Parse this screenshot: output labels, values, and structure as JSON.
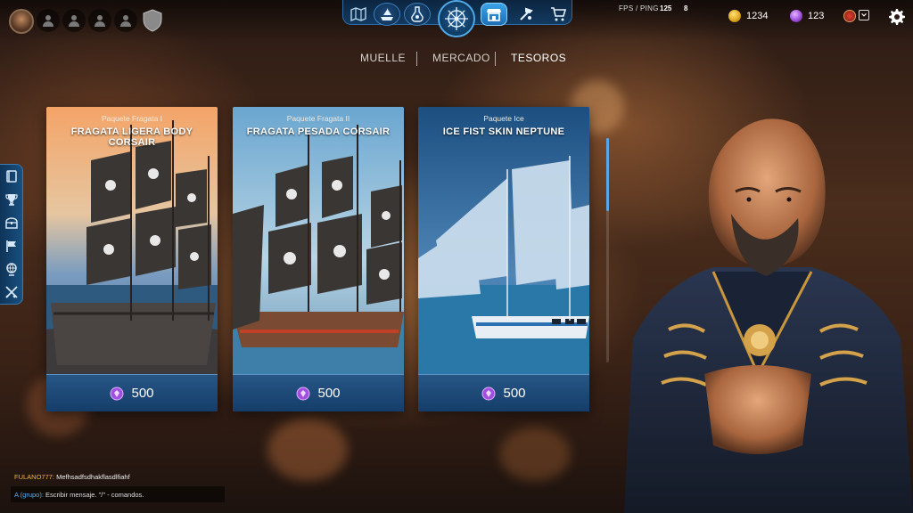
{
  "top_bar": {
    "avatar_icon": "pirate-portrait-avatar",
    "party_slots": [
      "person-icon",
      "person-icon",
      "person-icon",
      "person-icon"
    ],
    "guild_icon": "shield-icon",
    "fps_label": "FPS / PING",
    "fps_value": "125",
    "ping_value": "8",
    "gold_amount": "1234",
    "gems_amount": "123",
    "gold_color": "#e0a820",
    "gem_color": "#a050e0"
  },
  "nav": {
    "buttons": [
      "map-icon",
      "ship-icon",
      "potion-icon",
      "helm-icon",
      "shop-icon",
      "craft-icon",
      "cart-icon"
    ],
    "active": "shop-icon"
  },
  "tabs": {
    "items": [
      "MUELLE",
      "MERCADO",
      "TESOROS"
    ],
    "active": "TESOROS"
  },
  "side_rail": [
    "book-icon",
    "trophy-icon",
    "chest-icon",
    "flag-icon",
    "globe-icon",
    "crossed-swords-icon"
  ],
  "cards": [
    {
      "subtitle": "Paquete Fragata I",
      "title": "FRAGATA LIGERA BODY CORSAIR",
      "price": "500",
      "art": "dark-sail-frigate-sunset"
    },
    {
      "subtitle": "Paquete Fragata II",
      "title": "FRAGATA PESADA CORSAIR",
      "price": "500",
      "art": "heavy-frigate-jolly-roger"
    },
    {
      "subtitle": "Paquete Ice",
      "title": "ICE FIST SKIN NEPTUNE",
      "price": "500",
      "art": "ice-blue-sail-ship"
    }
  ],
  "chat": {
    "sender": "FULANO777:",
    "message": "Mefhsadfsdhakflasdlfiahf",
    "channel": "A (grupo):",
    "input_placeholder": "Escribir mensaje. \"/\" - comandos."
  }
}
